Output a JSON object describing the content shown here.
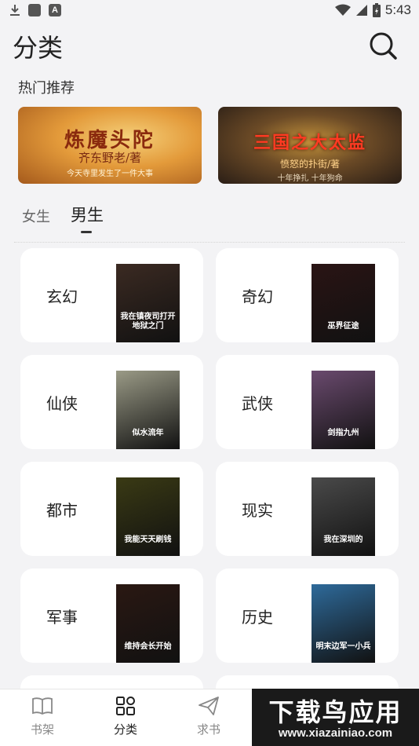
{
  "status_bar": {
    "time": "5:43"
  },
  "header": {
    "title": "分类"
  },
  "hot": {
    "title": "热门推荐",
    "banners": [
      {
        "title": "炼魔头陀",
        "author": "齐东野老/著",
        "subtitle": "今天寺里发生了一件大事"
      },
      {
        "title": "三国之大太监",
        "author": "愤怒的扑街/著",
        "subtitle": "十年挣扎  十年狗命"
      }
    ]
  },
  "tabs": [
    {
      "label": "女生",
      "active": false
    },
    {
      "label": "男生",
      "active": true
    }
  ],
  "categories": [
    {
      "label": "玄幻",
      "cover_text": "我在镇夜司打开地狱之门",
      "cover_color": "#3b2a22"
    },
    {
      "label": "奇幻",
      "cover_text": "巫界征途",
      "cover_color": "#2a1414"
    },
    {
      "label": "仙侠",
      "cover_text": "似水流年",
      "cover_color": "#9a9a86"
    },
    {
      "label": "武侠",
      "cover_text": "剑指九州",
      "cover_color": "#6a4a6e"
    },
    {
      "label": "都市",
      "cover_text": "我能天天刷钱",
      "cover_color": "#3a3a14"
    },
    {
      "label": "现实",
      "cover_text": "我在深圳的",
      "cover_color": "#4a4a4a"
    },
    {
      "label": "军事",
      "cover_text": "维持会长开始",
      "cover_color": "#2a1812"
    },
    {
      "label": "历史",
      "cover_text": "明末边军一小兵",
      "cover_color": "#2e6a9a"
    }
  ],
  "nav": {
    "items": [
      {
        "label": "书架",
        "icon": "book-icon",
        "active": false
      },
      {
        "label": "分类",
        "icon": "grid-icon",
        "active": true
      },
      {
        "label": "求书",
        "icon": "send-icon",
        "active": false
      }
    ]
  },
  "watermark": {
    "main": "下载鸟应用",
    "sub": "www.xiazainiao.com"
  }
}
